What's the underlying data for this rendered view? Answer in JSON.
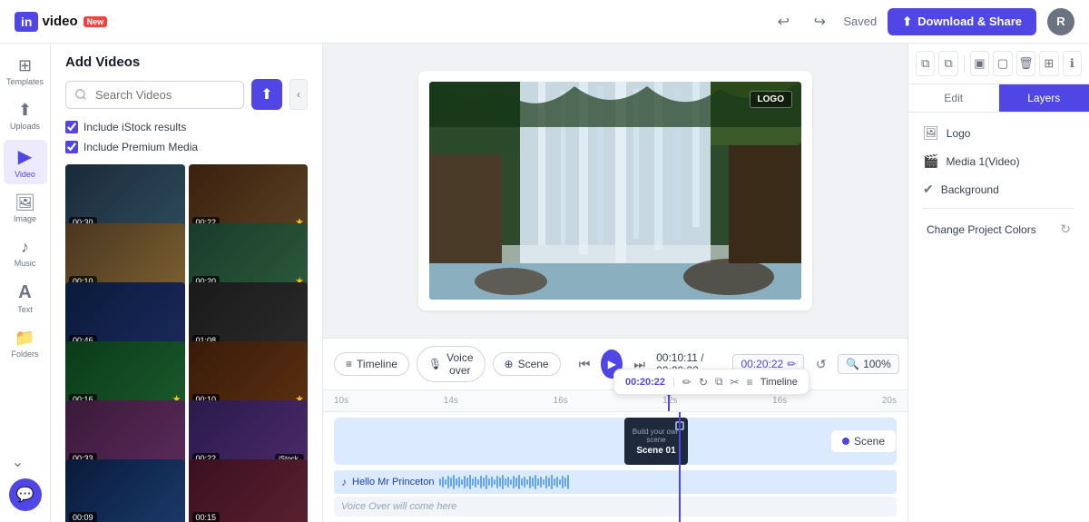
{
  "app": {
    "logo": "invideo",
    "new_badge": "New"
  },
  "topbar": {
    "undo_title": "Undo",
    "redo_title": "Redo",
    "saved_label": "Saved",
    "download_label": "Download & Share",
    "avatar_initial": "R"
  },
  "left_nav": {
    "items": [
      {
        "id": "templates",
        "icon": "⊞",
        "label": "Templates"
      },
      {
        "id": "uploads",
        "icon": "⬆",
        "label": "Uploads"
      },
      {
        "id": "video",
        "icon": "▶",
        "label": "Video",
        "active": true
      },
      {
        "id": "image",
        "icon": "🖼",
        "label": "Image"
      },
      {
        "id": "music",
        "icon": "♪",
        "label": "Music"
      },
      {
        "id": "text",
        "icon": "A",
        "label": "Text"
      },
      {
        "id": "folders",
        "icon": "📁",
        "label": "Folders"
      }
    ],
    "expand_icon": "⌄",
    "chat_icon": "💬"
  },
  "sidebar": {
    "title": "Add Videos",
    "search": {
      "placeholder": "Search Videos",
      "value": ""
    },
    "checkboxes": [
      {
        "id": "istock",
        "label": "Include iStock results",
        "checked": true
      },
      {
        "id": "premium",
        "label": "Include Premium Media",
        "checked": true
      }
    ],
    "videos": [
      {
        "duration": "00:30",
        "has_star": false,
        "color1": "#1a2a3a",
        "color2": "#2d4a5a"
      },
      {
        "duration": "00:22",
        "has_star": true,
        "color1": "#2a1a0a",
        "color2": "#4a3020"
      },
      {
        "duration": "00:10",
        "has_star": false,
        "color1": "#3a2a1a",
        "color2": "#5a4a2a"
      },
      {
        "duration": "00:20",
        "has_star": false,
        "color1": "#1a3a2a",
        "color2": "#2a5a3a"
      },
      {
        "duration": "00:46",
        "has_star": false,
        "color1": "#0a1a3a",
        "color2": "#1a2a5a"
      },
      {
        "duration": "01:08",
        "has_star": false,
        "color1": "#1a1a1a",
        "color2": "#2a2a2a"
      },
      {
        "duration": "00:16",
        "has_star": true,
        "color1": "#0a2a1a",
        "color2": "#1a4a2a"
      },
      {
        "duration": "00:10",
        "has_star": true,
        "color1": "#2a1a0a",
        "color2": "#4a3010"
      },
      {
        "duration": "00:33",
        "has_star": false,
        "color1": "#3a1a3a",
        "color2": "#5a2a5a"
      },
      {
        "duration": "00:22",
        "has_star": false,
        "is_istock": true,
        "color1": "#1a0a3a",
        "color2": "#2a1a5a"
      },
      {
        "duration": "00:09",
        "has_star": false,
        "color1": "#0a1a2a",
        "color2": "#1a2a4a"
      },
      {
        "duration": "00:15",
        "has_star": false,
        "color1": "#3a1a2a",
        "color2": "#5a2a3a"
      }
    ]
  },
  "timeline": {
    "buttons": [
      {
        "id": "timeline",
        "icon": "≡",
        "label": "Timeline"
      },
      {
        "id": "voiceover",
        "icon": "🎙",
        "label": "Voice over"
      },
      {
        "id": "scene",
        "icon": "⊕",
        "label": "Scene"
      }
    ],
    "current_time": "00:10:11",
    "total_time": "00:20:22",
    "edit_time": "00:20:22",
    "zoom": "100%",
    "ruler_marks": [
      "10s",
      "14s",
      "16s",
      "12s",
      "16s",
      "20s"
    ],
    "scene_popup": {
      "time": "00:20:22",
      "edit_icon": "✏",
      "refresh_icon": "↻",
      "copy_icon": "⧉",
      "scissors_icon": "✂",
      "timeline_icon": "≡",
      "label": "Timeline"
    },
    "scene_block": {
      "prompt": "Build your own scene",
      "name": "Scene 01"
    },
    "audio_track": {
      "icon": "♪",
      "label": "Hello Mr Princeton"
    },
    "voiceover_label": "Voice Over will come here",
    "scene_btn_label": "Scene"
  },
  "right_panel": {
    "tools": [
      "⧉",
      "⧉",
      "▣",
      "▢",
      "🗑",
      "⊞",
      "ℹ"
    ],
    "tabs": [
      {
        "id": "edit",
        "label": "Edit"
      },
      {
        "id": "layers",
        "label": "Layers",
        "active": true
      }
    ],
    "layers": [
      {
        "id": "logo",
        "icon": "🖼",
        "label": "Logo"
      },
      {
        "id": "media1",
        "icon": "🎬",
        "label": "Media 1(Video)"
      },
      {
        "id": "background",
        "icon": "✔",
        "label": "Background"
      }
    ],
    "change_colors_label": "Change Project Colors"
  }
}
